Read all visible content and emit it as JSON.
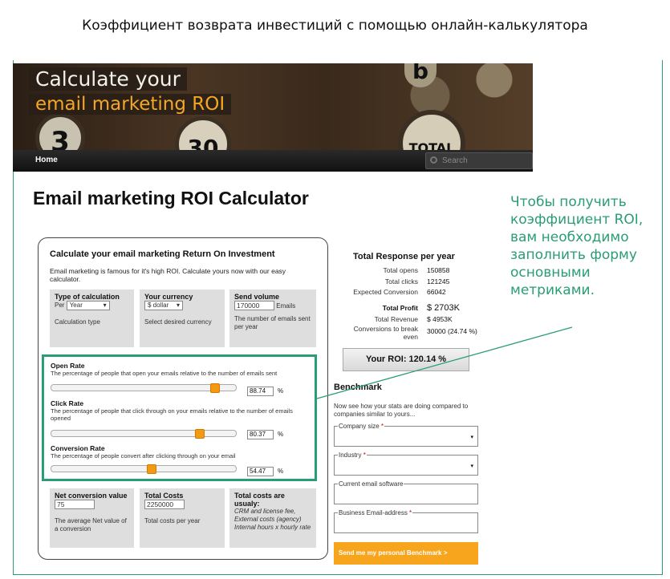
{
  "slide_title": "Коэффициент возврата инвестиций с помощью онлайн-калькулятора",
  "banner": {
    "line1": "Calculate your",
    "line2": "email marketing ROI",
    "coin_3": "3",
    "coin_30": "30",
    "coin_total": "TOTAL",
    "coin_b": "b"
  },
  "nav": {
    "home": "Home",
    "search_placeholder": "Search"
  },
  "page_heading": "Email marketing ROI Calculator",
  "calc": {
    "title": "Calculate your email marketing Return On Investment",
    "intro": "Email marketing is famous for it's high ROI. Calculate yours now with our easy calculator.",
    "type": {
      "label": "Type of calculation",
      "prefix": "Per",
      "value": "Year",
      "desc": "Calculation type"
    },
    "currency": {
      "label": "Your currency",
      "value": "$ dollar",
      "desc": "Select desired currency"
    },
    "volume": {
      "label": "Send volume",
      "value": "170000",
      "suffix": "Emails",
      "desc": "The number of emails sent per year"
    },
    "open_rate": {
      "label": "Open Rate",
      "desc": "The percentage of people that open your emails relative to the number of emails sent",
      "value": "88.74",
      "slider": 0.8874
    },
    "click_rate": {
      "label": "Click Rate",
      "desc": "The percentage of people that click through on your emails relative to the number of emails opened",
      "value": "80.37",
      "slider": 0.8037
    },
    "conversion_rate": {
      "label": "Conversion Rate",
      "desc": "The percentage of people convert after clicking through on your email",
      "value": "54.47",
      "slider": 0.5447
    },
    "pct": "%",
    "net_conversion": {
      "label": "Net conversion value",
      "value": "75",
      "desc": "The average Net value of a conversion"
    },
    "total_costs": {
      "label": "Total Costs",
      "value": "2250000",
      "desc": "Total costs per year"
    },
    "usual_costs": {
      "label": "Total costs are usualy:",
      "desc": "CRM and license fee, External costs (agency) Internal hours x hourly rate"
    }
  },
  "totals": {
    "title": "Total Response per year",
    "opens_label": "Total opens",
    "opens": "150858",
    "clicks_label": "Total clicks",
    "clicks": "121245",
    "conv_label": "Expected Conversion",
    "conv": "66042",
    "profit_label": "Total Profit",
    "profit": "$ 2703K",
    "revenue_label": "Total Revenue",
    "revenue": "$ 4953K",
    "break_label": "Conversions to break even",
    "break": "30000 (24.74 %)",
    "roi": "Your ROI: 120.14 %"
  },
  "benchmark": {
    "title": "Benchmark",
    "intro": "Now see how your stats are doing compared to companies similar to yours...",
    "company_size": "Company size",
    "industry": "Industry",
    "software": "Current email software",
    "email": "Business Email-address",
    "req": "*",
    "arrow": "▾",
    "submit": "Send me my personal Benchmark >"
  },
  "callout": "Чтобы получить коэффициент ROI, вам необходимо заполнить форму основными метриками.",
  "colors": {
    "accent_green": "#2a9d73",
    "orange": "#f7a51c"
  }
}
